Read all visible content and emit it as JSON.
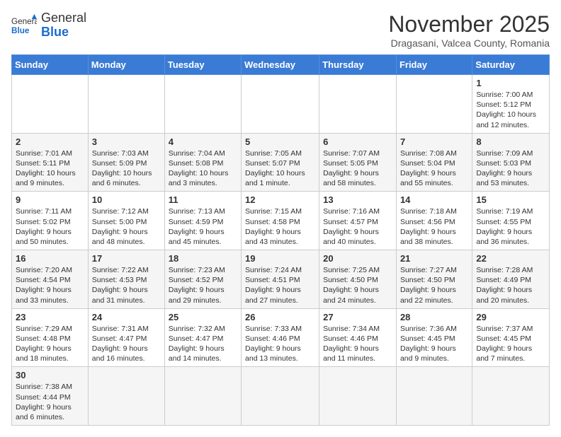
{
  "header": {
    "logo_general": "General",
    "logo_blue": "Blue",
    "month_title": "November 2025",
    "subtitle": "Dragasani, Valcea County, Romania"
  },
  "days_of_week": [
    "Sunday",
    "Monday",
    "Tuesday",
    "Wednesday",
    "Thursday",
    "Friday",
    "Saturday"
  ],
  "weeks": [
    [
      {
        "day": "",
        "info": ""
      },
      {
        "day": "",
        "info": ""
      },
      {
        "day": "",
        "info": ""
      },
      {
        "day": "",
        "info": ""
      },
      {
        "day": "",
        "info": ""
      },
      {
        "day": "",
        "info": ""
      },
      {
        "day": "1",
        "info": "Sunrise: 7:00 AM\nSunset: 5:12 PM\nDaylight: 10 hours and 12 minutes."
      }
    ],
    [
      {
        "day": "2",
        "info": "Sunrise: 7:01 AM\nSunset: 5:11 PM\nDaylight: 10 hours and 9 minutes."
      },
      {
        "day": "3",
        "info": "Sunrise: 7:03 AM\nSunset: 5:09 PM\nDaylight: 10 hours and 6 minutes."
      },
      {
        "day": "4",
        "info": "Sunrise: 7:04 AM\nSunset: 5:08 PM\nDaylight: 10 hours and 3 minutes."
      },
      {
        "day": "5",
        "info": "Sunrise: 7:05 AM\nSunset: 5:07 PM\nDaylight: 10 hours and 1 minute."
      },
      {
        "day": "6",
        "info": "Sunrise: 7:07 AM\nSunset: 5:05 PM\nDaylight: 9 hours and 58 minutes."
      },
      {
        "day": "7",
        "info": "Sunrise: 7:08 AM\nSunset: 5:04 PM\nDaylight: 9 hours and 55 minutes."
      },
      {
        "day": "8",
        "info": "Sunrise: 7:09 AM\nSunset: 5:03 PM\nDaylight: 9 hours and 53 minutes."
      }
    ],
    [
      {
        "day": "9",
        "info": "Sunrise: 7:11 AM\nSunset: 5:02 PM\nDaylight: 9 hours and 50 minutes."
      },
      {
        "day": "10",
        "info": "Sunrise: 7:12 AM\nSunset: 5:00 PM\nDaylight: 9 hours and 48 minutes."
      },
      {
        "day": "11",
        "info": "Sunrise: 7:13 AM\nSunset: 4:59 PM\nDaylight: 9 hours and 45 minutes."
      },
      {
        "day": "12",
        "info": "Sunrise: 7:15 AM\nSunset: 4:58 PM\nDaylight: 9 hours and 43 minutes."
      },
      {
        "day": "13",
        "info": "Sunrise: 7:16 AM\nSunset: 4:57 PM\nDaylight: 9 hours and 40 minutes."
      },
      {
        "day": "14",
        "info": "Sunrise: 7:18 AM\nSunset: 4:56 PM\nDaylight: 9 hours and 38 minutes."
      },
      {
        "day": "15",
        "info": "Sunrise: 7:19 AM\nSunset: 4:55 PM\nDaylight: 9 hours and 36 minutes."
      }
    ],
    [
      {
        "day": "16",
        "info": "Sunrise: 7:20 AM\nSunset: 4:54 PM\nDaylight: 9 hours and 33 minutes."
      },
      {
        "day": "17",
        "info": "Sunrise: 7:22 AM\nSunset: 4:53 PM\nDaylight: 9 hours and 31 minutes."
      },
      {
        "day": "18",
        "info": "Sunrise: 7:23 AM\nSunset: 4:52 PM\nDaylight: 9 hours and 29 minutes."
      },
      {
        "day": "19",
        "info": "Sunrise: 7:24 AM\nSunset: 4:51 PM\nDaylight: 9 hours and 27 minutes."
      },
      {
        "day": "20",
        "info": "Sunrise: 7:25 AM\nSunset: 4:50 PM\nDaylight: 9 hours and 24 minutes."
      },
      {
        "day": "21",
        "info": "Sunrise: 7:27 AM\nSunset: 4:50 PM\nDaylight: 9 hours and 22 minutes."
      },
      {
        "day": "22",
        "info": "Sunrise: 7:28 AM\nSunset: 4:49 PM\nDaylight: 9 hours and 20 minutes."
      }
    ],
    [
      {
        "day": "23",
        "info": "Sunrise: 7:29 AM\nSunset: 4:48 PM\nDaylight: 9 hours and 18 minutes."
      },
      {
        "day": "24",
        "info": "Sunrise: 7:31 AM\nSunset: 4:47 PM\nDaylight: 9 hours and 16 minutes."
      },
      {
        "day": "25",
        "info": "Sunrise: 7:32 AM\nSunset: 4:47 PM\nDaylight: 9 hours and 14 minutes."
      },
      {
        "day": "26",
        "info": "Sunrise: 7:33 AM\nSunset: 4:46 PM\nDaylight: 9 hours and 13 minutes."
      },
      {
        "day": "27",
        "info": "Sunrise: 7:34 AM\nSunset: 4:46 PM\nDaylight: 9 hours and 11 minutes."
      },
      {
        "day": "28",
        "info": "Sunrise: 7:36 AM\nSunset: 4:45 PM\nDaylight: 9 hours and 9 minutes."
      },
      {
        "day": "29",
        "info": "Sunrise: 7:37 AM\nSunset: 4:45 PM\nDaylight: 9 hours and 7 minutes."
      }
    ],
    [
      {
        "day": "30",
        "info": "Sunrise: 7:38 AM\nSunset: 4:44 PM\nDaylight: 9 hours and 6 minutes."
      },
      {
        "day": "",
        "info": ""
      },
      {
        "day": "",
        "info": ""
      },
      {
        "day": "",
        "info": ""
      },
      {
        "day": "",
        "info": ""
      },
      {
        "day": "",
        "info": ""
      },
      {
        "day": "",
        "info": ""
      }
    ]
  ]
}
